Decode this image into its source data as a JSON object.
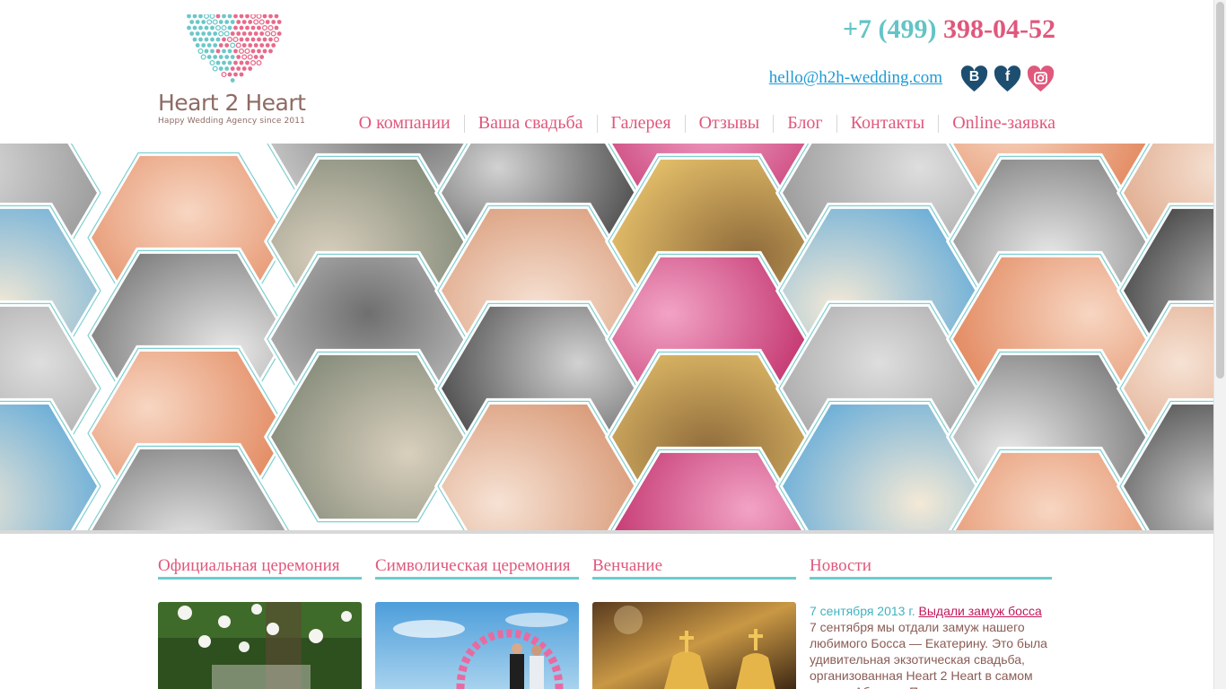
{
  "brand": {
    "name": "Heart 2 Heart",
    "tagline": "Happy Wedding Agency since 2011"
  },
  "contacts": {
    "phone_code": "+7 (499)",
    "phone_number": "398-04-52",
    "email": "hello@h2h-wedding.com"
  },
  "social": [
    {
      "name": "vk",
      "glyph": "B",
      "color": "#1d4e70"
    },
    {
      "name": "facebook",
      "glyph": "f",
      "color": "#1d4e70"
    },
    {
      "name": "instagram",
      "glyph": "instagram-icon",
      "color": "#e0587c"
    }
  ],
  "nav": {
    "items": [
      {
        "label": "О компании"
      },
      {
        "label": "Ваша свадьба"
      },
      {
        "label": "Галерея"
      },
      {
        "label": "Отзывы"
      },
      {
        "label": "Блог"
      },
      {
        "label": "Контакты"
      },
      {
        "label": "Online-заявка"
      }
    ]
  },
  "gallery": {
    "description_icons": [
      "photo-tile"
    ]
  },
  "columns": {
    "official": {
      "title": "Официальная церемония"
    },
    "symbolic": {
      "title": "Символическая церемония"
    },
    "church": {
      "title": "Венчание"
    },
    "news": {
      "title": "Новости"
    }
  },
  "news": {
    "date": "7 сентября 2013 г.",
    "title": "Выдали замуж босса",
    "text": "7 сентября мы отдали замуж нашего любимого Босса — Екатерину. Это была удивительная экзотическая свадьба, организованная Heart 2 Heart в самом сердце Абхазии. Потрясающая"
  },
  "colors": {
    "pink": "#e0587c",
    "teal": "#64c4c6",
    "link_blue": "#1e9ad6",
    "brown": "#8b5c55"
  }
}
